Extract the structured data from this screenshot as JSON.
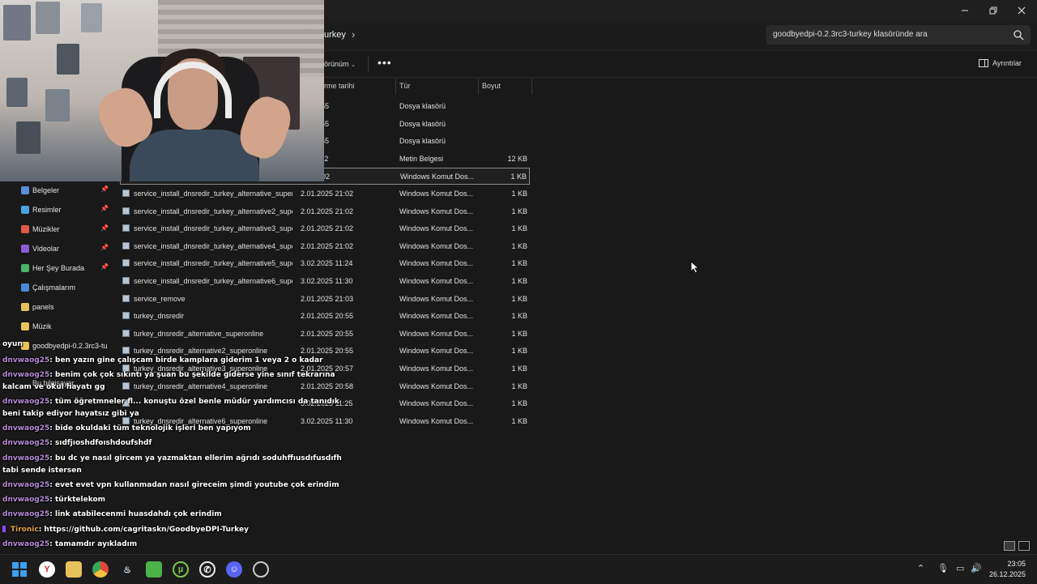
{
  "window": {
    "breadcrumb": "urkey",
    "search_placeholder": "goodbyedpi-0.2.3rc3-turkey klasöründe ara"
  },
  "toolbar": {
    "view_label": "örünüm",
    "more_label": "•••",
    "details_label": "Ayrıntılar"
  },
  "columns": {
    "date": "rme tarihi",
    "type": "Tür",
    "size": "Boyut"
  },
  "files": [
    {
      "name": "",
      "date": "25 20:55",
      "type": "Dosya klasörü",
      "size": "",
      "folder": true
    },
    {
      "name": "",
      "date": "25 20:55",
      "type": "Dosya klasörü",
      "size": "",
      "folder": true
    },
    {
      "name": "",
      "date": "25 20:55",
      "type": "Dosya klasörü",
      "size": "",
      "folder": true
    },
    {
      "name": "",
      "date": "25 11:32",
      "type": "Metin Belgesi",
      "size": "12 KB"
    },
    {
      "name": "",
      "date": "25 21:02",
      "type": "Windows Komut Dos...",
      "size": "1 KB",
      "selected": true
    },
    {
      "name": "service_install_dnsredir_turkey_alternative_super...",
      "date": "2.01.2025 21:02",
      "type": "Windows Komut Dos...",
      "size": "1 KB"
    },
    {
      "name": "service_install_dnsredir_turkey_alternative2_supe...",
      "date": "2.01.2025 21:02",
      "type": "Windows Komut Dos...",
      "size": "1 KB"
    },
    {
      "name": "service_install_dnsredir_turkey_alternative3_supe...",
      "date": "2.01.2025 21:02",
      "type": "Windows Komut Dos...",
      "size": "1 KB"
    },
    {
      "name": "service_install_dnsredir_turkey_alternative4_supe...",
      "date": "2.01.2025 21:02",
      "type": "Windows Komut Dos...",
      "size": "1 KB"
    },
    {
      "name": "service_install_dnsredir_turkey_alternative5_supe...",
      "date": "3.02.2025 11:24",
      "type": "Windows Komut Dos...",
      "size": "1 KB"
    },
    {
      "name": "service_install_dnsredir_turkey_alternative6_supe...",
      "date": "3.02.2025 11:30",
      "type": "Windows Komut Dos...",
      "size": "1 KB"
    },
    {
      "name": "service_remove",
      "date": "2.01.2025 21:03",
      "type": "Windows Komut Dos...",
      "size": "1 KB"
    },
    {
      "name": "turkey_dnsredir",
      "date": "2.01.2025 20:55",
      "type": "Windows Komut Dos...",
      "size": "1 KB"
    },
    {
      "name": "turkey_dnsredir_alternative_superonline",
      "date": "2.01.2025 20:55",
      "type": "Windows Komut Dos...",
      "size": "1 KB"
    },
    {
      "name": "turkey_dnsredir_alternative2_superonline",
      "date": "2.01.2025 20:55",
      "type": "Windows Komut Dos...",
      "size": "1 KB"
    },
    {
      "name": "turkey_dnsredir_alternative3_superonline",
      "date": "2.01.2025 20:57",
      "type": "Windows Komut Dos...",
      "size": "1 KB"
    },
    {
      "name": "turkey_dnsredir_alternative4_superonline",
      "date": "2.01.2025 20:58",
      "type": "Windows Komut Dos...",
      "size": "1 KB"
    },
    {
      "name": "",
      "date": "3.02.2025 11:25",
      "type": "Windows Komut Dos...",
      "size": "1 KB"
    },
    {
      "name": "turkey_dnsredir_alternative6_superonline",
      "date": "3.02.2025 11:30",
      "type": "Windows Komut Dos...",
      "size": "1 KB"
    }
  ],
  "sidebar": [
    {
      "label": "Belgeler",
      "pinned": true,
      "color": "#5b8ed6"
    },
    {
      "label": "Resimler",
      "pinned": true,
      "color": "#4aa3e0"
    },
    {
      "label": "Müzikler",
      "pinned": true,
      "color": "#e05a4a"
    },
    {
      "label": "Videolar",
      "pinned": true,
      "color": "#8a5ad6"
    },
    {
      "label": "Her Şey Burada",
      "pinned": true,
      "color": "#4ab36a"
    },
    {
      "label": "Çalışmalarım",
      "pinned": false,
      "color": "#4a8ad6"
    },
    {
      "label": "panels",
      "pinned": false,
      "color": "#e6c35a"
    },
    {
      "label": "Müzik",
      "pinned": false,
      "color": "#e6c35a"
    },
    {
      "label": "goodbyedpi-0.2.3rc3-tu",
      "pinned": false,
      "color": "#e6c35a"
    }
  ],
  "chat": [
    {
      "user": "",
      "text": "oyun"
    },
    {
      "user": "dnvwaog25",
      "text": ": ben yazın gine çalışcam birde kamplara giderim 1 veya 2 o kadar"
    },
    {
      "user": "dnvwaog25",
      "text": ": benim çok çok sıkıntı ya şuan bu şekilde giderse yine sınıf tekrarına"
    },
    {
      "user": "",
      "text": "kalcam ve okul hayatı gg"
    },
    {
      "user": "dnvwaog25",
      "text": ": tüm öğretmneler fl... konuştu özel benle müdür yardımcısı da tanıdık"
    },
    {
      "user": "",
      "text": "beni takip ediyor hayatsız gibi ya"
    },
    {
      "user": "dnvwaog25",
      "text": ": bide okuldaki tüm teknolojik işleri ben yapıyom"
    },
    {
      "user": "dnvwaog25",
      "text": ": sıdfjıoshdfoıshdoufshdf"
    },
    {
      "user": "dnvwaog25",
      "text": ": bu dc ye nasıl gircem ya yazmaktan ellerim ağrıdı soduhffıusdıfusdıfh"
    },
    {
      "user": "",
      "text": "tabi sende istersen"
    },
    {
      "user": "dnvwaog25",
      "text": ": evet evet vpn kullanmadan nasıl gireceim şimdi youtube çok erindim"
    },
    {
      "user": "dnvwaog25",
      "text": ": türktelekom"
    },
    {
      "user": "dnvwaog25",
      "text": ": link atabilecenmi huasdahdı çok erindim"
    },
    {
      "user": "Tironic",
      "text": ": https://github.com/cagritaskn/GoodbyeDPI-Turkey",
      "alt": true
    },
    {
      "user": "dnvwaog25",
      "text": ": tamamdır ayıkladım"
    },
    {
      "user": "dnvwaog25",
      "text": ": SOIDHFSUIGDIFSGDIFSIDUF"
    }
  ],
  "overlay_labels": {
    "this_pc": "Bu bilgisayar"
  },
  "taskbar": {
    "time": "23:05",
    "date": "26.12.2025"
  }
}
